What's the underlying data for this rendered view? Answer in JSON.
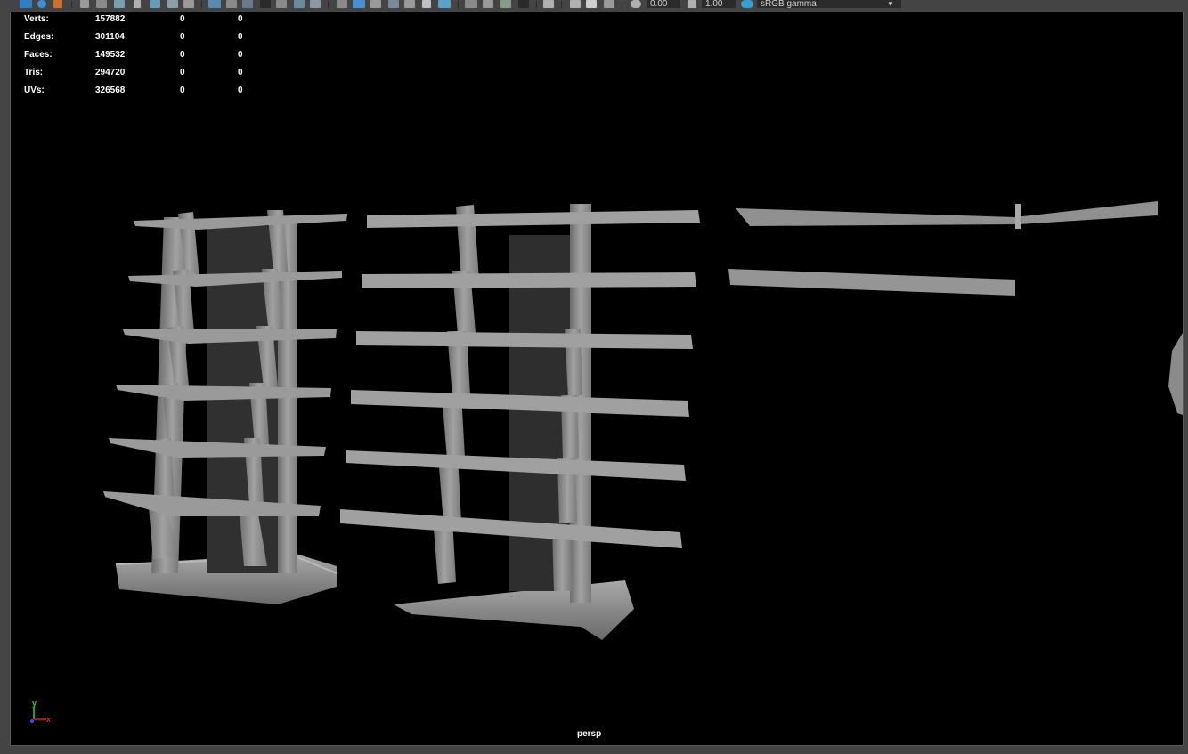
{
  "toolbar": {
    "exposure_value": "0.00",
    "gamma_value": "1.00",
    "color_space": "sRGB gamma",
    "colors": {
      "bg": "#444444",
      "field": "#2b2b2b",
      "active_icon": "#2f7fc1"
    }
  },
  "hud": {
    "rows": [
      {
        "label": "Verts:",
        "total": "157882",
        "selected": "0",
        "component": "0"
      },
      {
        "label": "Edges:",
        "total": "301104",
        "selected": "0",
        "component": "0"
      },
      {
        "label": "Faces:",
        "total": "149532",
        "selected": "0",
        "component": "0"
      },
      {
        "label": "Tris:",
        "total": "294720",
        "selected": "0",
        "component": "0"
      },
      {
        "label": "UVs:",
        "total": "326568",
        "selected": "0",
        "component": "0"
      }
    ]
  },
  "viewport": {
    "camera": "persp",
    "axis": {
      "y_label": "y",
      "x_label": "x",
      "y_color": "#2ecc40",
      "x_color": "#e02020",
      "z_color": "#3050ff"
    },
    "model_color": "#8c8c8c"
  }
}
